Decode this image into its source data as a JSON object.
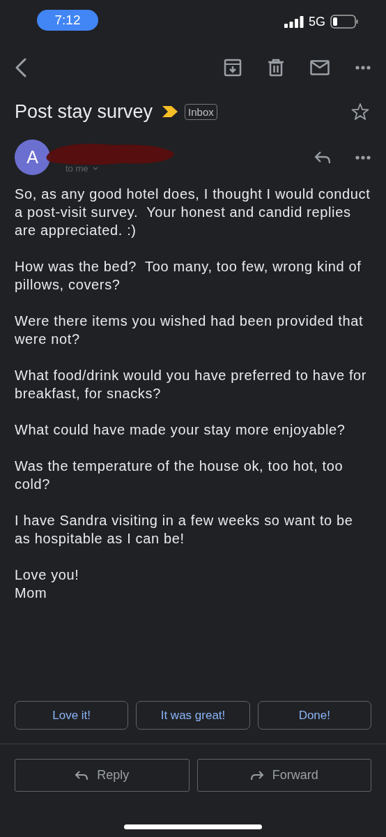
{
  "status_bar": {
    "time": "7:12",
    "network": "5G"
  },
  "email": {
    "subject": "Post stay survey",
    "important": true,
    "label": "Inbox",
    "starred": false,
    "sender": {
      "initial": "A",
      "recipient": "to me"
    },
    "body": [
      "So, as any good hotel does, I thought I would conduct a post-visit survey.  Your honest and candid replies are appreciated. :)",
      "How was the bed?  Too many, too few, wrong kind of pillows, covers?",
      "Were there items you wished had been provided that were not?",
      "What food/drink would you have preferred to have for breakfast, for snacks?",
      "What could have made your stay more enjoyable?",
      "Was the temperature of the house ok, too hot, too cold?",
      "I have Sandra visiting in a few weeks so want to be as hospitable as I can be!",
      "Love you!\nMom"
    ]
  },
  "smart_replies": [
    "Love it!",
    "It was great!",
    "Done!"
  ],
  "actions": [
    {
      "kind": "reply",
      "label": "Reply"
    },
    {
      "kind": "forward",
      "label": "Forward"
    }
  ]
}
